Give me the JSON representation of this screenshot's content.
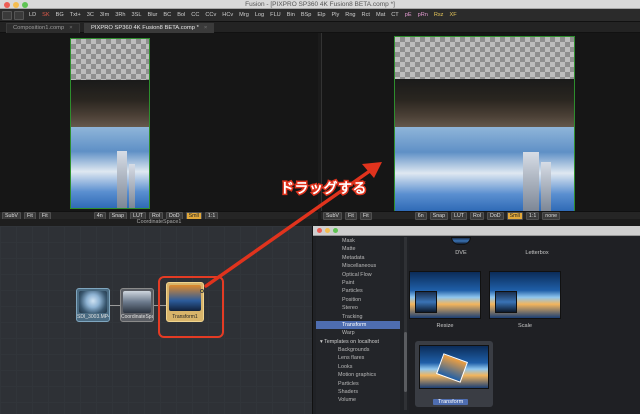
{
  "window": {
    "title": "Fusion - [PIXPRO SP360 4K Fusion8 BETA.comp *]"
  },
  "toolbar": {
    "buttons": [
      "LD",
      "SK",
      "BG",
      "Txt+",
      "3C",
      "3Im",
      "3Rh",
      "3SL",
      "Blur",
      "BC",
      "Bol",
      "CC",
      "CCv",
      "HCv",
      "Mrg",
      "Log",
      "FLU",
      "Bin",
      "BSp",
      "Elp",
      "Ply",
      "Rng",
      "Rct",
      "Mat",
      "CT",
      "pE",
      "pRn",
      "Rsz",
      "XF"
    ]
  },
  "tabs": [
    {
      "label": "Composition1.comp",
      "active": false
    },
    {
      "label": "PIXPRO SP360 4K Fusion8 BETA.comp *",
      "active": true
    }
  ],
  "viewer_left": {
    "bar": [
      "SubV",
      "Fit",
      "Fit",
      "4n",
      "Snap",
      "LUT",
      "Rol",
      "DoD",
      "Smll",
      "1:1"
    ],
    "caption": "CoordinateSpace1"
  },
  "viewer_right": {
    "bar": [
      "SubV",
      "Fit",
      "Fit",
      "6n",
      "Snap",
      "LUT",
      "Rol",
      "DoD",
      "Smll",
      "1:1",
      "none"
    ]
  },
  "annotation": {
    "text": "ドラッグする",
    "color": "#e0331d"
  },
  "nodes": [
    {
      "label": "SDI_3003.MP4",
      "color": "#4a6b82"
    },
    {
      "label": "CoordinateSpace1",
      "color": "#5a5d63"
    },
    {
      "label": "Transform1",
      "color": "#d8b46a"
    }
  ],
  "bins": {
    "categories": [
      "Mask",
      "Matte",
      "Metadata",
      "Miscellaneous",
      "Optical Flow",
      "Paint",
      "Particles",
      "Position",
      "Stereo",
      "Tracking",
      "Transform",
      "Warp"
    ],
    "selected": "Transform",
    "group": "Templates on localhost",
    "templates": [
      "Backgrounds",
      "Lens flares",
      "Looks",
      "Motion graphics",
      "Particles",
      "Shaders",
      "Volume"
    ],
    "tiles": [
      {
        "label": "DVE"
      },
      {
        "label": "Letterbox"
      },
      {
        "label": "Resize"
      },
      {
        "label": "Scale"
      },
      {
        "label": "Transform"
      }
    ]
  }
}
